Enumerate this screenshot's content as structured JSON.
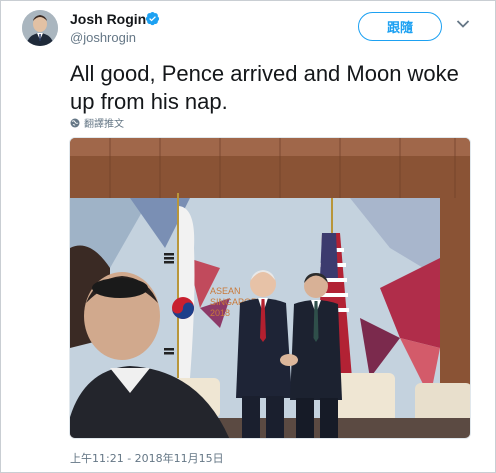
{
  "author": {
    "display_name": "Josh Rogin",
    "handle": "@joshrogin",
    "verified": true
  },
  "header": {
    "follow_label": "跟隨",
    "caret_icon": "chevron-down-icon"
  },
  "tweet": {
    "text": "All good, Pence arrived and Moon woke up from his nap.",
    "translate_label": "翻譯推文",
    "timestamp": "上午11:21 - 2018年11月15日"
  },
  "photo": {
    "backdrop_text_1": "ASEAN",
    "backdrop_text_2": "SINGAPORE",
    "backdrop_text_3": "2018"
  },
  "colors": {
    "accent": "#1da1f2",
    "secondary_text": "#657786",
    "primary_text": "#14171a"
  }
}
